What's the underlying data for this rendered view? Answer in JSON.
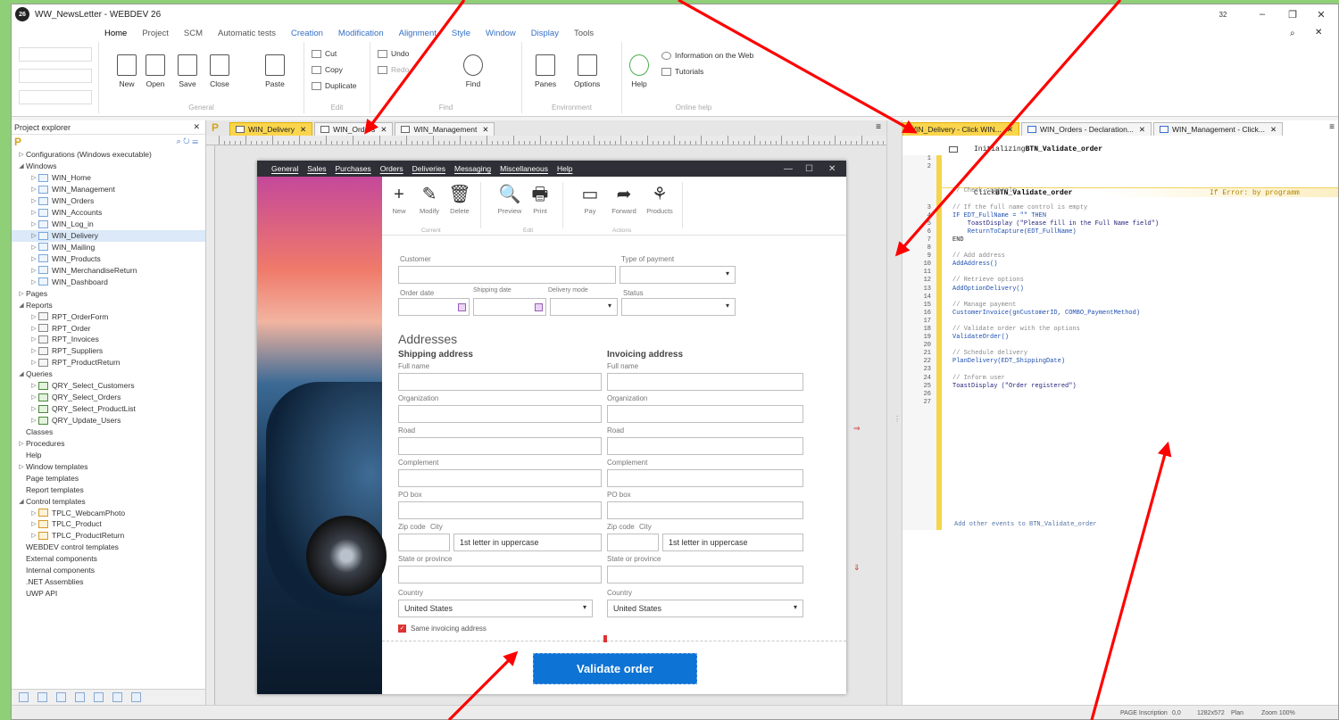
{
  "window": {
    "title": "WW_NewsLetter - WEBDEV 26",
    "badge": "32",
    "minimize": "–",
    "restore": "❐",
    "close": "✕"
  },
  "ribbon": {
    "tabs": [
      "Home",
      "Project",
      "SCM",
      "Automatic tests",
      "Creation",
      "Modification",
      "Alignment",
      "Style",
      "Window",
      "Display",
      "Tools"
    ],
    "buttons": {
      "new": "New",
      "open": "Open",
      "save": "Save",
      "close": "Close",
      "paste": "Paste",
      "cut": "Cut",
      "copy": "Copy",
      "duplicate": "Duplicate",
      "undo": "Undo",
      "redo": "Redo",
      "find": "Find",
      "panes": "Panes",
      "options": "Options",
      "help": "Help",
      "info_web": "Information on the Web",
      "tutorials": "Tutorials"
    },
    "group_labels": [
      "General",
      "Edit",
      "Find",
      "Environment",
      "Online help"
    ]
  },
  "explorer": {
    "title": "Project explorer",
    "items": [
      {
        "label": "Configurations (Windows executable)",
        "level": 0,
        "arrow": "▷",
        "icon": ""
      },
      {
        "label": "Windows",
        "level": 0,
        "arrow": "◢",
        "icon": ""
      },
      {
        "label": "WIN_Home",
        "level": 1,
        "arrow": "▷",
        "icon": "win"
      },
      {
        "label": "WIN_Management",
        "level": 1,
        "arrow": "▷",
        "icon": "win"
      },
      {
        "label": "WIN_Orders",
        "level": 1,
        "arrow": "▷",
        "icon": "win"
      },
      {
        "label": "WIN_Accounts",
        "level": 1,
        "arrow": "▷",
        "icon": "win"
      },
      {
        "label": "WIN_Log_in",
        "level": 1,
        "arrow": "▷",
        "icon": "win"
      },
      {
        "label": "WIN_Delivery",
        "level": 1,
        "arrow": "▷",
        "icon": "win",
        "selected": true
      },
      {
        "label": "WIN_Mailing",
        "level": 1,
        "arrow": "▷",
        "icon": "win"
      },
      {
        "label": "WIN_Products",
        "level": 1,
        "arrow": "▷",
        "icon": "win"
      },
      {
        "label": "WIN_MerchandiseReturn",
        "level": 1,
        "arrow": "▷",
        "icon": "win"
      },
      {
        "label": "WIN_Dashboard",
        "level": 1,
        "arrow": "▷",
        "icon": "win"
      },
      {
        "label": "Pages",
        "level": 0,
        "arrow": "▷",
        "icon": ""
      },
      {
        "label": "Reports",
        "level": 0,
        "arrow": "◢",
        "icon": ""
      },
      {
        "label": "RPT_OrderForm",
        "level": 1,
        "arrow": "▷",
        "icon": "rep"
      },
      {
        "label": "RPT_Order",
        "level": 1,
        "arrow": "▷",
        "icon": "rep"
      },
      {
        "label": "RPT_Invoices",
        "level": 1,
        "arrow": "▷",
        "icon": "rep"
      },
      {
        "label": "RPT_Suppliers",
        "level": 1,
        "arrow": "▷",
        "icon": "rep"
      },
      {
        "label": "RPT_ProductReturn",
        "level": 1,
        "arrow": "▷",
        "icon": "rep"
      },
      {
        "label": "Queries",
        "level": 0,
        "arrow": "◢",
        "icon": ""
      },
      {
        "label": "QRY_Select_Customers",
        "level": 1,
        "arrow": "▷",
        "icon": "qry"
      },
      {
        "label": "QRY_Select_Orders",
        "level": 1,
        "arrow": "▷",
        "icon": "qry"
      },
      {
        "label": "QRY_Select_ProductList",
        "level": 1,
        "arrow": "▷",
        "icon": "qry"
      },
      {
        "label": "QRY_Update_Users",
        "level": 1,
        "arrow": "▷",
        "icon": "qry"
      },
      {
        "label": "Classes",
        "level": 0,
        "arrow": "",
        "icon": ""
      },
      {
        "label": "Procedures",
        "level": 0,
        "arrow": "▷",
        "icon": ""
      },
      {
        "label": "Help",
        "level": 0,
        "arrow": "",
        "icon": ""
      },
      {
        "label": "Window templates",
        "level": 0,
        "arrow": "▷",
        "icon": ""
      },
      {
        "label": "Page templates",
        "level": 0,
        "arrow": "",
        "icon": ""
      },
      {
        "label": "Report templates",
        "level": 0,
        "arrow": "",
        "icon": ""
      },
      {
        "label": "Control templates",
        "level": 0,
        "arrow": "◢",
        "icon": ""
      },
      {
        "label": "TPLC_WebcamPhoto",
        "level": 1,
        "arrow": "▷",
        "icon": "tpl"
      },
      {
        "label": "TPLC_Product",
        "level": 1,
        "arrow": "▷",
        "icon": "tpl"
      },
      {
        "label": "TPLC_ProductReturn",
        "level": 1,
        "arrow": "▷",
        "icon": "tpl"
      },
      {
        "label": "WEBDEV control templates",
        "level": 0,
        "arrow": "",
        "icon": ""
      },
      {
        "label": "External components",
        "level": 0,
        "arrow": "",
        "icon": ""
      },
      {
        "label": "Internal components",
        "level": 0,
        "arrow": "",
        "icon": ""
      },
      {
        "label": ".NET Assemblies",
        "level": 0,
        "arrow": "",
        "icon": ""
      },
      {
        "label": "UWP API",
        "level": 0,
        "arrow": "",
        "icon": ""
      }
    ]
  },
  "designer_tabs": [
    {
      "label": "WIN_Delivery",
      "active": true
    },
    {
      "label": "WIN_Orders",
      "active": false
    },
    {
      "label": "WIN_Management",
      "active": false
    }
  ],
  "form": {
    "menu": [
      "General",
      "Sales",
      "Purchases",
      "Orders",
      "Deliveries",
      "Messaging",
      "Miscellaneous",
      "Help"
    ],
    "toolbar": [
      {
        "label": "New",
        "glyph": "+"
      },
      {
        "label": "Modify",
        "glyph": "✎"
      },
      {
        "label": "Delete",
        "glyph": "🗑"
      },
      {
        "label": "Preview",
        "glyph": "🔍"
      },
      {
        "label": "Print",
        "glyph": "🖶"
      },
      {
        "label": "Pay",
        "glyph": "▭"
      },
      {
        "label": "Forward",
        "glyph": "➦"
      },
      {
        "label": "Products",
        "glyph": "⚘"
      }
    ],
    "toolbar_groups": [
      "Current",
      "Edit",
      "Actions"
    ],
    "labels": {
      "customer": "Customer",
      "type_of_payment": "Type of payment",
      "order_date": "Order date",
      "shipping_date": "Shipping date",
      "delivery_mode": "Delivery mode",
      "status": "Status",
      "addresses": "Addresses",
      "shipping_address": "Shipping address",
      "invoicing_address": "Invoicing address",
      "full_name": "Full name",
      "organization": "Organization",
      "road": "Road",
      "complement": "Complement",
      "po_box": "PO box",
      "zip_code": "Zip code",
      "city": "City",
      "state": "State or province",
      "country": "Country",
      "same_invoicing": "Same invoicing address"
    },
    "values": {
      "city_placeholder": "1st letter in uppercase",
      "country": "United States"
    },
    "validate_button": "Validate order"
  },
  "code_tabs": [
    {
      "label": "WIN_Delivery - Click WIN..."
    },
    {
      "label": "WIN_Orders - Declaration..."
    },
    {
      "label": "WIN_Management - Click..."
    }
  ],
  "code": {
    "init_header_prefix": "Initializing ",
    "init_header_name": "BTN_Validate_order",
    "click_header_prefix": "Click ",
    "click_header_name": "BTN_Validate_order",
    "on_error": "If Error: by programm",
    "lines": [
      {
        "n": "1",
        "t": "",
        "c": ""
      },
      {
        "n": "2",
        "t": "",
        "c": ""
      },
      {
        "n": "",
        "t": "",
        "c": ""
      },
      {
        "n": "",
        "t": "",
        "c": ""
      },
      {
        "n": "",
        "t": "// Check controls",
        "c": "c-com"
      },
      {
        "n": "",
        "t": "",
        "c": ""
      },
      {
        "n": "3",
        "t": "// If the full name control is empty",
        "c": "c-com"
      },
      {
        "n": "4",
        "t": "IF EDT_FullName = \"\" THEN",
        "c": "c-kw"
      },
      {
        "n": "5",
        "t": "    ToastDisplay (\"Please fill in the Full Name field\")",
        "c": "c-str"
      },
      {
        "n": "6",
        "t": "    ReturnToCapture(EDT_FullName)",
        "c": "c-fn"
      },
      {
        "n": "7",
        "t": "END",
        "c": ""
      },
      {
        "n": "8",
        "t": "",
        "c": ""
      },
      {
        "n": "9",
        "t": "// Add address",
        "c": "c-com"
      },
      {
        "n": "10",
        "t": "AddAddress()",
        "c": "c-fn"
      },
      {
        "n": "11",
        "t": "",
        "c": ""
      },
      {
        "n": "12",
        "t": "// Retrieve options",
        "c": "c-com"
      },
      {
        "n": "13",
        "t": "AddOptionDelivery()",
        "c": "c-fn"
      },
      {
        "n": "14",
        "t": "",
        "c": ""
      },
      {
        "n": "15",
        "t": "// Manage payment",
        "c": "c-com"
      },
      {
        "n": "16",
        "t": "CustomerInvoice(gnCustomerID, COMBO_PaymentMethod)",
        "c": "c-fn"
      },
      {
        "n": "17",
        "t": "",
        "c": ""
      },
      {
        "n": "18",
        "t": "// Validate order with the options",
        "c": "c-com"
      },
      {
        "n": "19",
        "t": "ValidateOrder()",
        "c": "c-fn"
      },
      {
        "n": "20",
        "t": "",
        "c": ""
      },
      {
        "n": "21",
        "t": "// Schedule delivery",
        "c": "c-com"
      },
      {
        "n": "22",
        "t": "PlanDelivery(EDT_ShippingDate)",
        "c": "c-fn"
      },
      {
        "n": "23",
        "t": "",
        "c": ""
      },
      {
        "n": "24",
        "t": "// Inform user",
        "c": "c-com"
      },
      {
        "n": "25",
        "t": "ToastDisplay (\"Order registered\")",
        "c": "c-str"
      },
      {
        "n": "26",
        "t": "",
        "c": ""
      },
      {
        "n": "27",
        "t": "",
        "c": ""
      }
    ],
    "add_events": "Add other events to BTN_Validate_order"
  },
  "status": {
    "mode": "PAGE Inscription",
    "pos": "0,0",
    "size": "1282x572",
    "plan": "Plan",
    "zoom": "Zoom 100%"
  },
  "colors": {
    "accent_tab": "#fbd54c",
    "validate": "#0d73d4",
    "arrow": "#ff0000",
    "background": "#8fcf78"
  }
}
